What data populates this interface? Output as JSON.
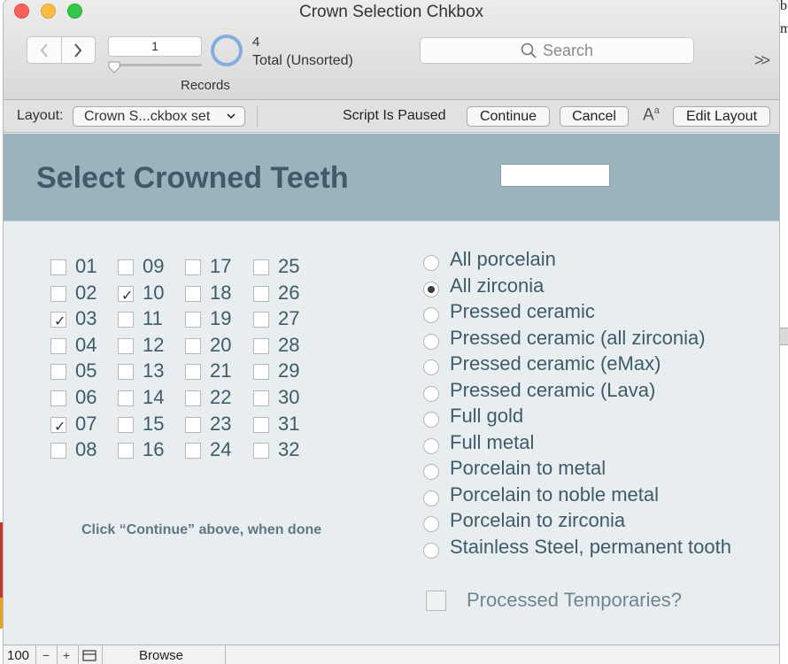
{
  "window": {
    "title": "Crown Selection Chkbox"
  },
  "toolbar": {
    "current_record": "1",
    "records_label": "Records",
    "found_count": "4",
    "found_status": "Total (Unsorted)",
    "search_placeholder": "Search",
    "more_label": ">>"
  },
  "layout_bar": {
    "layout_label": "Layout:",
    "layout_selected": "Crown S...ckbox set",
    "script_status": "Script Is Paused",
    "continue_label": "Continue",
    "cancel_label": "Cancel",
    "text_format_label": "A",
    "text_format_sup": "a",
    "edit_layout_label": "Edit Layout"
  },
  "header": {
    "title": "Select Crowned Teeth",
    "field_value": ""
  },
  "teeth": [
    {
      "num": "01",
      "checked": false
    },
    {
      "num": "02",
      "checked": false
    },
    {
      "num": "03",
      "checked": true
    },
    {
      "num": "04",
      "checked": false
    },
    {
      "num": "05",
      "checked": false
    },
    {
      "num": "06",
      "checked": false
    },
    {
      "num": "07",
      "checked": true
    },
    {
      "num": "08",
      "checked": false
    },
    {
      "num": "09",
      "checked": false
    },
    {
      "num": "10",
      "checked": true
    },
    {
      "num": "11",
      "checked": false
    },
    {
      "num": "12",
      "checked": false
    },
    {
      "num": "13",
      "checked": false
    },
    {
      "num": "14",
      "checked": false
    },
    {
      "num": "15",
      "checked": false
    },
    {
      "num": "16",
      "checked": false
    },
    {
      "num": "17",
      "checked": false
    },
    {
      "num": "18",
      "checked": false
    },
    {
      "num": "19",
      "checked": false
    },
    {
      "num": "20",
      "checked": false
    },
    {
      "num": "21",
      "checked": false
    },
    {
      "num": "22",
      "checked": false
    },
    {
      "num": "23",
      "checked": false
    },
    {
      "num": "24",
      "checked": false
    },
    {
      "num": "25",
      "checked": false
    },
    {
      "num": "26",
      "checked": false
    },
    {
      "num": "27",
      "checked": false
    },
    {
      "num": "28",
      "checked": false
    },
    {
      "num": "29",
      "checked": false
    },
    {
      "num": "30",
      "checked": false
    },
    {
      "num": "31",
      "checked": false
    },
    {
      "num": "32",
      "checked": false
    }
  ],
  "check_mark": "✓",
  "materials": [
    {
      "label": "All porcelain",
      "selected": false
    },
    {
      "label": "All zirconia",
      "selected": true
    },
    {
      "label": "Pressed ceramic",
      "selected": false
    },
    {
      "label": "Pressed ceramic (all zirconia)",
      "selected": false
    },
    {
      "label": "Pressed ceramic (eMax)",
      "selected": false
    },
    {
      "label": "Pressed ceramic (Lava)",
      "selected": false
    },
    {
      "label": "Full gold",
      "selected": false
    },
    {
      "label": "Full metal",
      "selected": false
    },
    {
      "label": "Porcelain to metal",
      "selected": false
    },
    {
      "label": "Porcelain to noble metal",
      "selected": false
    },
    {
      "label": "Porcelain to zirconia",
      "selected": false
    },
    {
      "label": "Stainless Steel, permanent tooth",
      "selected": false
    }
  ],
  "hint": "Click “Continue” above, when done",
  "temporaries": {
    "label": "Processed Temporaries?",
    "checked": false
  },
  "status_bar": {
    "zoom": "100",
    "zoom_out": "−",
    "zoom_in": "+",
    "mode": "Browse"
  },
  "desktop": {
    "frag_b": "b",
    "frag_m": "m"
  }
}
